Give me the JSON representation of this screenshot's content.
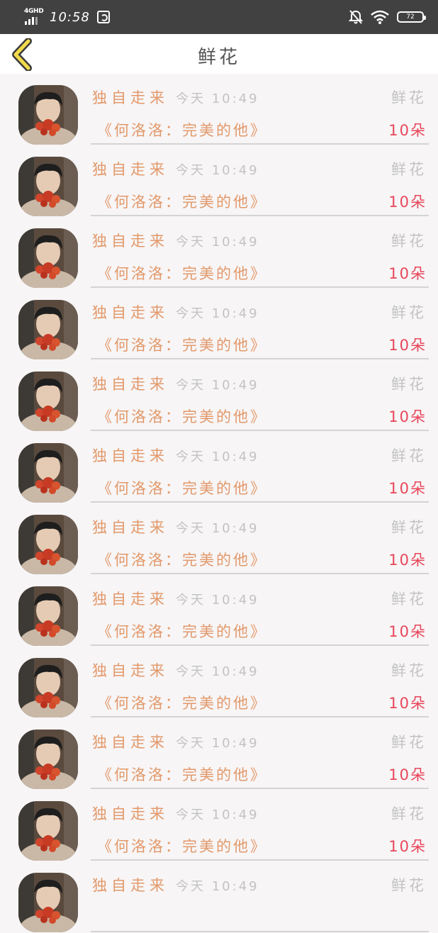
{
  "status_bar": {
    "network": "4GHD",
    "time": "10:58",
    "battery": "72"
  },
  "nav": {
    "title": "鲜花"
  },
  "items": [
    {
      "user": "独自走来",
      "time": "今天 10:49",
      "type": "鲜花",
      "book": "《何洛洛：完美的他》",
      "amount": "10朵"
    },
    {
      "user": "独自走来",
      "time": "今天 10:49",
      "type": "鲜花",
      "book": "《何洛洛：完美的他》",
      "amount": "10朵"
    },
    {
      "user": "独自走来",
      "time": "今天 10:49",
      "type": "鲜花",
      "book": "《何洛洛：完美的他》",
      "amount": "10朵"
    },
    {
      "user": "独自走来",
      "time": "今天 10:49",
      "type": "鲜花",
      "book": "《何洛洛：完美的他》",
      "amount": "10朵"
    },
    {
      "user": "独自走来",
      "time": "今天 10:49",
      "type": "鲜花",
      "book": "《何洛洛：完美的他》",
      "amount": "10朵"
    },
    {
      "user": "独自走来",
      "time": "今天 10:49",
      "type": "鲜花",
      "book": "《何洛洛：完美的他》",
      "amount": "10朵"
    },
    {
      "user": "独自走来",
      "time": "今天 10:49",
      "type": "鲜花",
      "book": "《何洛洛：完美的他》",
      "amount": "10朵"
    },
    {
      "user": "独自走来",
      "time": "今天 10:49",
      "type": "鲜花",
      "book": "《何洛洛：完美的他》",
      "amount": "10朵"
    },
    {
      "user": "独自走来",
      "time": "今天 10:49",
      "type": "鲜花",
      "book": "《何洛洛：完美的他》",
      "amount": "10朵"
    },
    {
      "user": "独自走来",
      "time": "今天 10:49",
      "type": "鲜花",
      "book": "《何洛洛：完美的他》",
      "amount": "10朵"
    },
    {
      "user": "独自走来",
      "time": "今天 10:49",
      "type": "鲜花",
      "book": "《何洛洛：完美的他》",
      "amount": "10朵"
    },
    {
      "user": "独自走来",
      "time": "今天 10:49",
      "type": "鲜花",
      "book": "",
      "amount": ""
    }
  ],
  "colors": {
    "accent_orange": "#e2996b",
    "amount_red": "#e8475a",
    "back_arrow_fill": "#f2da4c",
    "status_bar_bg": "#414141"
  },
  "icons": {
    "back": "chevron-left-icon",
    "mute": "bell-off-icon",
    "wifi": "wifi-icon",
    "battery": "battery-icon",
    "app": "app-notification-icon"
  }
}
